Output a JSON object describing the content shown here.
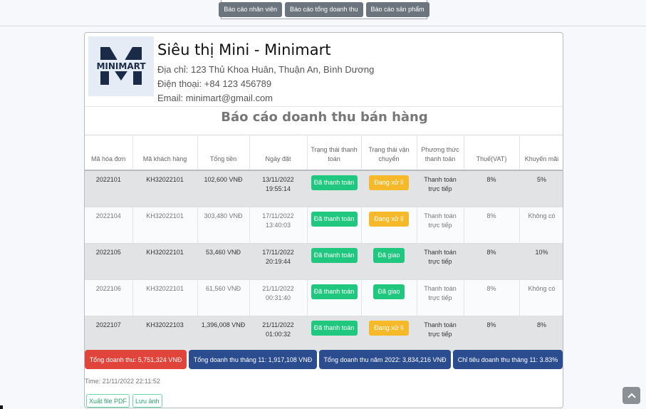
{
  "topnav": {
    "buttons": [
      "Báo cáo nhân viên",
      "Báo cáo tổng doanh thu",
      "Báo cáo sản phẩm"
    ]
  },
  "store": {
    "logo_text": "MINIMART",
    "name": "Siêu thị Mini - Minimart",
    "address": "Địa chỉ: 123 Thủ Khoa Huân, Thuận An, Bình Dương",
    "phone": "Điện thoại: +84 123 456789",
    "email": "Email: minimart@gmail.com"
  },
  "report": {
    "title": "Báo cáo doanh thu bán hàng",
    "columns": [
      "Mã hóa đơn",
      "Mã khách hàng",
      "Tổng tiền",
      "Ngày đặt",
      "Trạng thái thanh toán",
      "Trạng thái vận chuyển",
      "Phương thức thanh toán",
      "Thuế(VAT)",
      "Khuyến mãi"
    ],
    "rows": [
      {
        "id": "2022101",
        "customer": "KH32022101",
        "total": "102,600 VNĐ",
        "date": "13/11/2022",
        "time": "19:55:14",
        "payment_status": "Đã thanh toán",
        "shipping_status": "Đang xử lí",
        "method": "Thanh toán trực tiếp",
        "vat": "8%",
        "discount": "5%"
      },
      {
        "id": "2022104",
        "customer": "KH32022101",
        "total": "303,480 VNĐ",
        "date": "17/11/2022",
        "time": "13:40:03",
        "payment_status": "Đã thanh toán",
        "shipping_status": "Đang xử lí",
        "method": "Thanh toán trực tiếp",
        "vat": "8%",
        "discount": "Không có"
      },
      {
        "id": "2022105",
        "customer": "KH32022101",
        "total": "53,460 VNĐ",
        "date": "17/11/2022",
        "time": "20:19:44",
        "payment_status": "Đã thanh toán",
        "shipping_status": "Đã giao",
        "method": "Thanh toán trực tiếp",
        "vat": "8%",
        "discount": "10%"
      },
      {
        "id": "2022106",
        "customer": "KH32022101",
        "total": "61,560 VNĐ",
        "date": "21/11/2022",
        "time": "00:31:40",
        "payment_status": "Đã thanh toán",
        "shipping_status": "Đã giao",
        "method": "Thanh toán trực tiếp",
        "vat": "8%",
        "discount": "Không có"
      },
      {
        "id": "2022107",
        "customer": "KH32022103",
        "total": "1,396,008 VNĐ",
        "date": "21/11/2022",
        "time": "01:00:32",
        "payment_status": "Đã thanh toán",
        "shipping_status": "Đang xử lí",
        "method": "Thanh toán trực tiếp",
        "vat": "8%",
        "discount": "8%"
      }
    ]
  },
  "summary": {
    "total": "Tổng doanh thu: 5,751,324 VNĐ",
    "month_total": "Tổng doanh thu tháng 11: 1,917,108 VNĐ",
    "year_total": "Tổng doanh thu năm 2022: 3,834,216 VNĐ",
    "target": "Chỉ tiêu doanh thu tháng 11: 3.83%"
  },
  "timestamp": "Time: 21/11/2022 22:11:52",
  "actions": {
    "export_pdf": "Xuất file PDF",
    "save_image": "Lưu ảnh"
  },
  "colors": {
    "paid": "#20c77e",
    "processing": "#f5b92a",
    "total_red": "#e0443a",
    "summary_blue": "#2b4d8f",
    "logo_navy": "#1b2a47"
  },
  "icons": {
    "scroll_top": "chevron-up-icon"
  }
}
